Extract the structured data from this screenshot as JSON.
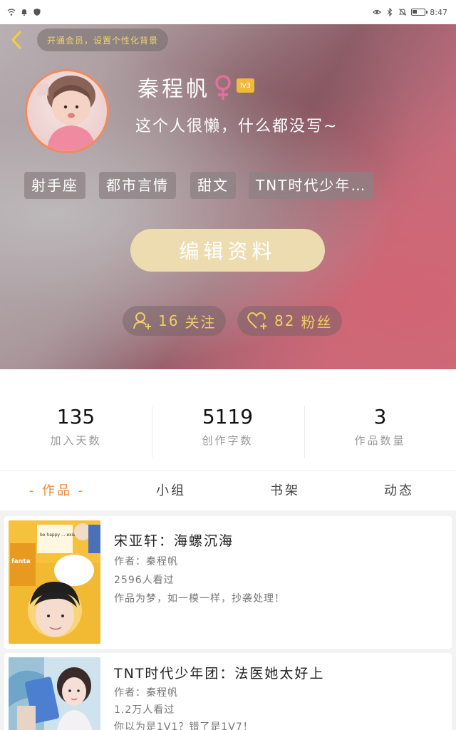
{
  "status_bar": {
    "time": "8:47"
  },
  "header": {
    "vip_prompt": "开通会员，设置个性化背景"
  },
  "profile": {
    "name": "秦程帆",
    "level": "lv3",
    "bio": "这个人很懒，什么都没写~",
    "tags": [
      "射手座",
      "都市言情",
      "甜文",
      "TNT时代少年…"
    ],
    "edit_label": "编辑资料",
    "following": {
      "count": "16",
      "label": "关注"
    },
    "followers": {
      "count": "82",
      "label": "粉丝"
    }
  },
  "stats": [
    {
      "value": "135",
      "label": "加入天数"
    },
    {
      "value": "5119",
      "label": "创作字数"
    },
    {
      "value": "3",
      "label": "作品数量"
    }
  ],
  "tabs": [
    {
      "label": "- 作品 -",
      "active": true
    },
    {
      "label": "小组",
      "active": false
    },
    {
      "label": "书架",
      "active": false
    },
    {
      "label": "动态",
      "active": false
    }
  ],
  "works": [
    {
      "title": "宋亚轩：海螺沉海",
      "author": "作者：秦程帆",
      "views": "2596人看过",
      "desc": "作品为梦，如一模一样，抄袭处理！",
      "cover_text": "be happy ... exist",
      "cover_brand": "fanta"
    },
    {
      "title": "TNT时代少年团：法医她太好上",
      "author": "作者：秦程帆",
      "views": "1.2万人看过",
      "desc": "你以为是1V1？错了是1V7！"
    }
  ],
  "colors": {
    "accent_orange": "#ee8a3f",
    "gold": "#f0cf64",
    "edit_button": "#eddcb0",
    "level_badge": "#f3b93a"
  }
}
